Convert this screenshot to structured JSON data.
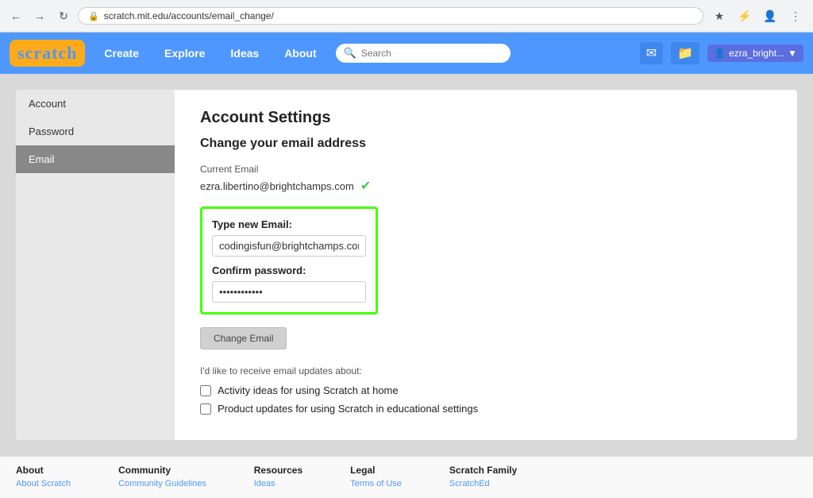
{
  "browser": {
    "url": "scratch.mit.edu/accounts/email_change/",
    "back_btn": "←",
    "forward_btn": "→",
    "refresh_btn": "↻"
  },
  "nav": {
    "logo": "Scratch",
    "links": [
      "Create",
      "Explore",
      "Ideas",
      "About"
    ],
    "search_placeholder": "Search",
    "user_name": "ezra_bright..."
  },
  "sidebar": {
    "items": [
      {
        "label": "Account",
        "active": false
      },
      {
        "label": "Password",
        "active": false
      },
      {
        "label": "Email",
        "active": true
      }
    ]
  },
  "content": {
    "page_title": "Account Settings",
    "section_title": "Change your email address",
    "current_email_label": "Current Email",
    "current_email_value": "ezra.libertino@brightchamps.com",
    "new_email_label": "Type new Email:",
    "new_email_value": "codingisfun@brightchamps.com",
    "confirm_password_label": "Confirm password:",
    "confirm_password_value": "••••••••••••",
    "change_email_btn": "Change Email",
    "updates_label": "I'd like to receive email updates about:",
    "checkbox1_label": "Activity ideas for using Scratch at home",
    "checkbox2_label": "Product updates for using Scratch in educational settings"
  },
  "footer": {
    "columns": [
      {
        "heading": "About",
        "links": [
          "About Scratch"
        ]
      },
      {
        "heading": "Community",
        "links": [
          "Community Guidelines"
        ]
      },
      {
        "heading": "Resources",
        "links": [
          "Ideas"
        ]
      },
      {
        "heading": "Legal",
        "links": [
          "Terms of Use"
        ]
      },
      {
        "heading": "Scratch Family",
        "links": [
          "ScratchEd"
        ]
      }
    ]
  }
}
